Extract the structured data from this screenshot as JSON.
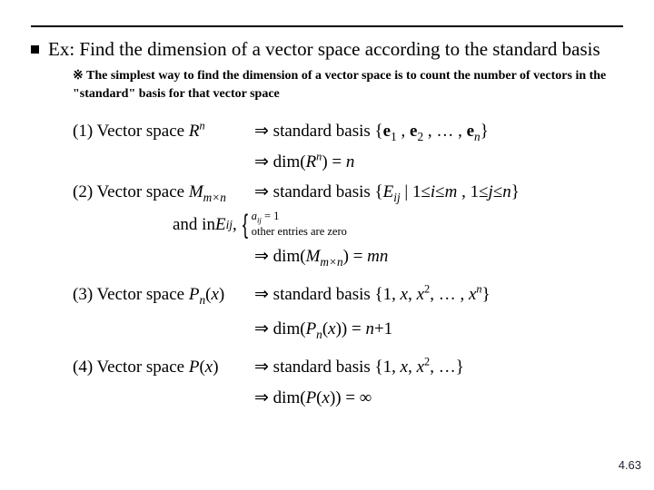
{
  "title": "Ex: Find the dimension of a vector space according to the standard basis",
  "note_prefix": "※",
  "note": "The simplest way to find the dimension of a vector space is to count the number of vectors in the \"standard\" basis for that vector space",
  "items": {
    "i1": {
      "label_a": "(1) Vector space ",
      "label_b": "R",
      "label_sup": "n",
      "r1a": "⇒ standard basis ",
      "r1b": "{",
      "r1c": "e",
      "r1sub1": "1",
      "r1d": " , ",
      "r1e": "e",
      "r1sub2": "2",
      "r1f": " , … , ",
      "r1g": "e",
      "r1subn": "n",
      "r1h": "}",
      "r2a": "⇒ dim(",
      "r2b": "R",
      "r2sup": "n",
      "r2c": ") = ",
      "r2d": "n"
    },
    "i2": {
      "label_a": "(2) Vector space ",
      "label_b": "M",
      "label_sub": "m×n",
      "r1a": "⇒ standard basis {",
      "r1b": "E",
      "r1sub": "ij",
      "r1c": " | 1≤",
      "r1i": "i",
      "r1d": "≤",
      "r1m": "m",
      "r1e": " , 1≤",
      "r1j": "j",
      "r1f": "≤",
      "r1n": "n",
      "r1g": "}",
      "eij_a": "and in ",
      "eij_b": "E",
      "eij_sub": "ij",
      "eij_c": " ,",
      "brace_l1a": "a",
      "brace_l1sub": "ij",
      "brace_l1b": " = 1",
      "brace_l2": "other entries are zero",
      "r2a": "⇒ dim(",
      "r2b": "M",
      "r2sub": "m×n",
      "r2c": ") = ",
      "r2d": "mn"
    },
    "i3": {
      "label_a": "(3) Vector space ",
      "label_b": "P",
      "label_sub": "n",
      "label_c": "(",
      "label_d": "x",
      "label_e": ")",
      "r1a": "⇒ standard basis {1, ",
      "r1x1": "x",
      "r1b": ", ",
      "r1x2": "x",
      "r1sup2": "2",
      "r1c": ", … , ",
      "r1xn": "x",
      "r1supn": "n",
      "r1d": "}",
      "r2a": "⇒ dim(",
      "r2b": "P",
      "r2sub": "n",
      "r2c": "(",
      "r2d": "x",
      "r2e": ")) = ",
      "r2f": "n",
      "r2g": "+1"
    },
    "i4": {
      "label_a": "(4) Vector space ",
      "label_b": "P",
      "label_c": "(",
      "label_d": "x",
      "label_e": ")",
      "r1a": "⇒ standard basis {1, ",
      "r1x1": "x",
      "r1b": ", ",
      "r1x2": "x",
      "r1sup2": "2",
      "r1c": ", …}",
      "r2a": "⇒ dim(",
      "r2b": "P",
      "r2c": "(",
      "r2d": "x",
      "r2e": ")) = ∞"
    }
  },
  "pagenum": "4.63"
}
